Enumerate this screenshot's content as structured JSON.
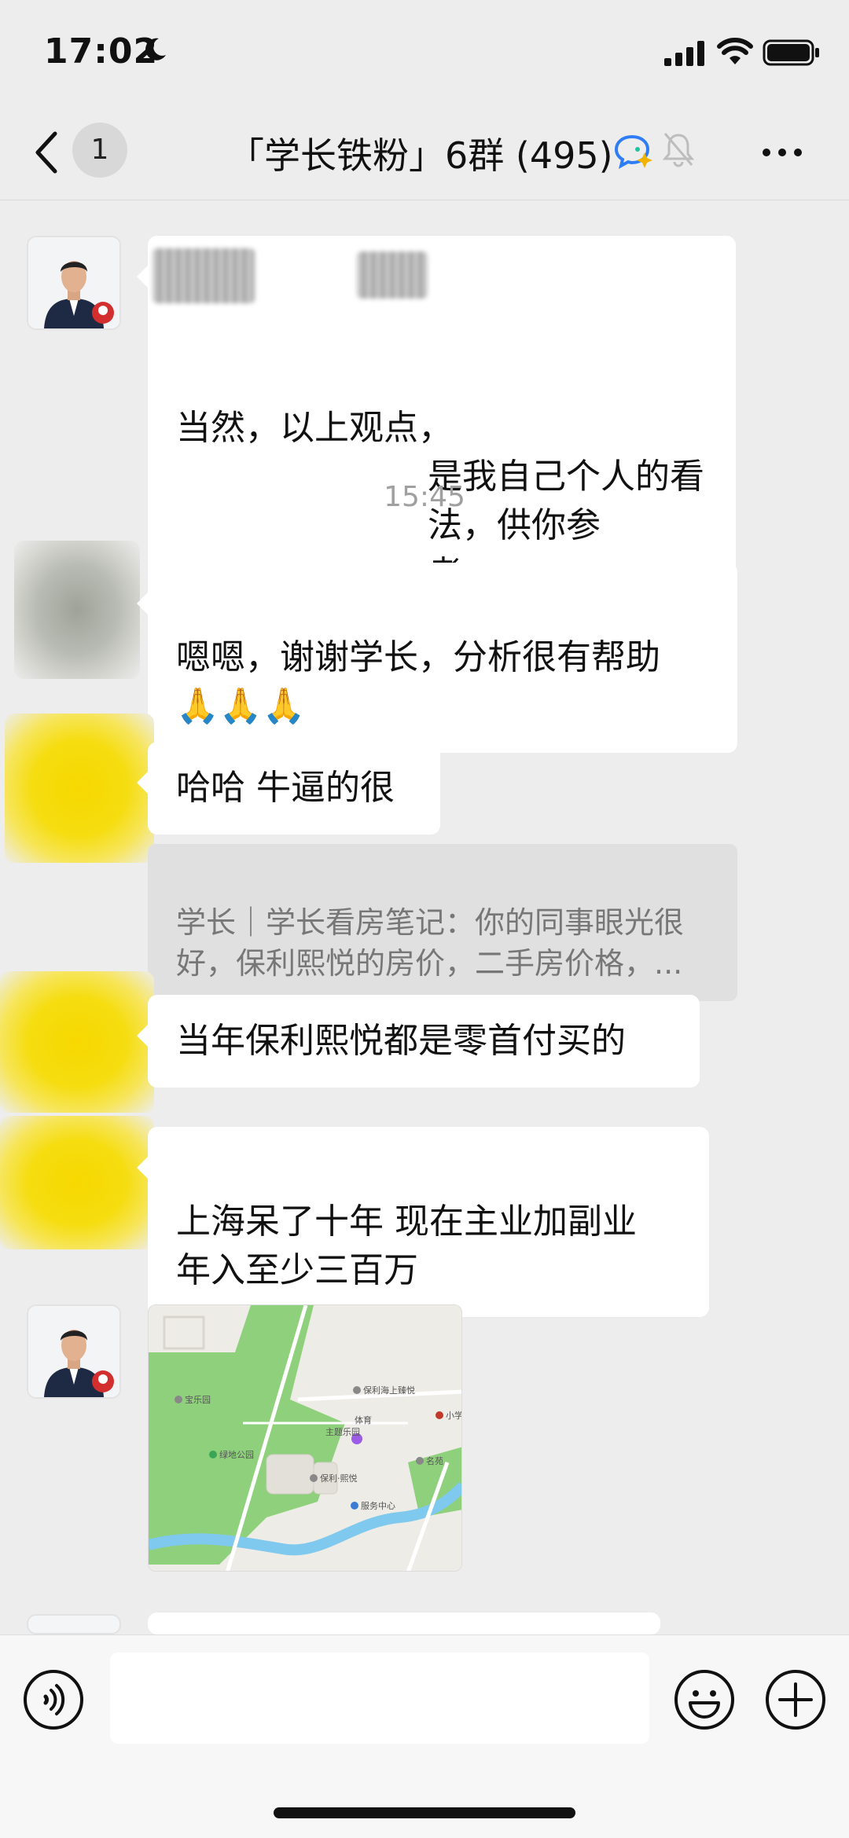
{
  "status_bar": {
    "time": "17:02"
  },
  "header": {
    "unread_count": "1",
    "title": "「学长铁粉」6群 (495)"
  },
  "messages": [
    {
      "text": "当然，以上观点，\n是我自己个人的看法，供你参\n考。"
    },
    {
      "time_label": "15:45"
    },
    {
      "text": "嗯嗯，谢谢学长，分析很有帮助\n🙏🙏🙏"
    },
    {
      "text": "哈哈 牛逼的很"
    },
    {
      "quote": "学长｜学长看房笔记：你的同事眼光很\n好，保利熙悦的房价，二手房价格，..."
    },
    {
      "text": "当年保利熙悦都是零首付买的"
    },
    {
      "text": "上海呆了十年 现在主业加副业\n年入至少三百万"
    }
  ],
  "map": {
    "labels": [
      "宝乐园",
      "保利海上臻悦",
      "主题乐园",
      "绿地公园",
      "保利·熙悦",
      "体育",
      "服务中心",
      "小学",
      "名苑"
    ]
  },
  "colors": {
    "background": "#ededed",
    "bubble": "#ffffff",
    "quote_bg": "#e0e0e0"
  }
}
